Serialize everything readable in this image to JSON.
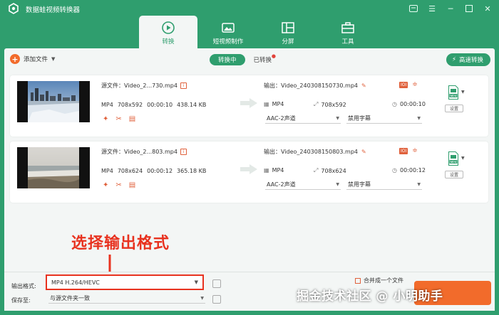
{
  "app": {
    "title": "数据蛙视频转换器"
  },
  "nav_tabs": [
    {
      "label": "转换",
      "icon": "convert-icon",
      "active": true
    },
    {
      "label": "短视频制作",
      "icon": "short-video-icon",
      "active": false
    },
    {
      "label": "分屏",
      "icon": "split-screen-icon",
      "active": false
    },
    {
      "label": "工具",
      "icon": "toolbox-icon",
      "active": false
    }
  ],
  "toolbar": {
    "add_file": "添加文件",
    "converting": "转换中",
    "converted": "已转换",
    "fast_convert": "高速转换"
  },
  "files": [
    {
      "source_label": "源文件：Video_2...730.mp4",
      "format": "MP4",
      "resolution": "708x592",
      "duration": "00:00:10",
      "size": "438.14 KB",
      "output_label": "输出：Video_240308150730.mp4",
      "out_format": "MP4",
      "out_resolution": "708x592",
      "out_duration": "00:00:10",
      "audio": "AAC-2声道",
      "subtitle": "禁用字幕",
      "settings": "设置",
      "format_badge": "MP4"
    },
    {
      "source_label": "源文件：Video_2...803.mp4",
      "format": "MP4",
      "resolution": "708x624",
      "duration": "00:00:12",
      "size": "365.18 KB",
      "output_label": "输出：Video_240308150803.mp4",
      "out_format": "MP4",
      "out_resolution": "708x624",
      "out_duration": "00:00:12",
      "audio": "AAC-2声道",
      "subtitle": "禁用字幕",
      "settings": "设置",
      "format_badge": "MP4"
    }
  ],
  "annotation": "选择输出格式",
  "bottom": {
    "output_format_label": "输出格式:",
    "output_format_value": "MP4 H.264/HEVC",
    "save_to_label": "保存至:",
    "save_to_value": "与源文件夹一致",
    "merge_label": "合并成一个文件"
  },
  "watermark": "掘金技术社区 @ 小明助手",
  "colors": {
    "brand": "#2f9e6e",
    "accent": "#f26b2b",
    "highlight": "#e8321f"
  }
}
